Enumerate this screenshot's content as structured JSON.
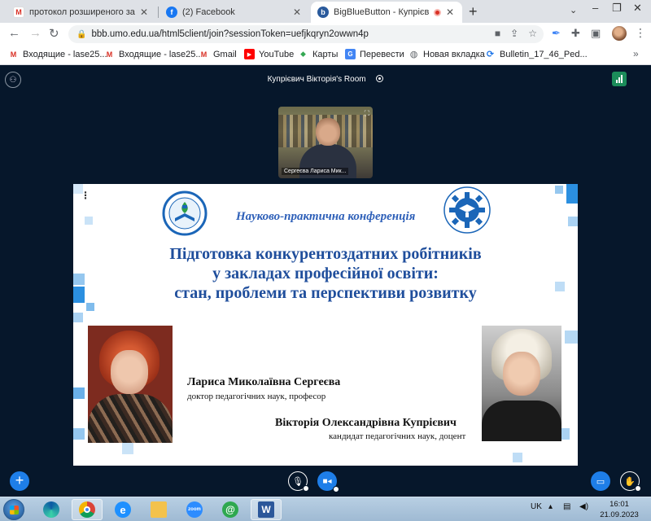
{
  "browser": {
    "tabs": [
      {
        "label": "протокол розширеного засідання",
        "favicon": "gmail-icon",
        "active": false
      },
      {
        "label": "(2) Facebook",
        "favicon": "facebook-icon",
        "active": false
      },
      {
        "label": "BigBlueButton - Купрієвич В",
        "favicon": "bigbluebutton-icon",
        "active": true
      }
    ],
    "url": "bbb.umo.edu.ua/html5client/join?sessionToken=uefjkqryn2owwn4p",
    "bookmarks": [
      {
        "label": "Входящие - lase25...",
        "icon": "gmail-icon"
      },
      {
        "label": "Входящие - lase25...",
        "icon": "gmail-icon"
      },
      {
        "label": "Gmail",
        "icon": "gmail-icon"
      },
      {
        "label": "YouTube",
        "icon": "youtube-icon"
      },
      {
        "label": "Карты",
        "icon": "maps-icon"
      },
      {
        "label": "Перевести",
        "icon": "translate-icon"
      },
      {
        "label": "Новая вкладка",
        "icon": "globe-icon"
      },
      {
        "label": "Bulletin_17_46_Ped...",
        "icon": "link-icon"
      }
    ]
  },
  "meeting": {
    "room_title": "Купрієвич Вікторія's Room",
    "webcam_name": "Сергеєва Лариса Мик..."
  },
  "slide": {
    "conference": "Науково-практична конференція",
    "title_lines": [
      "Підготовка конкурентоздатних робітників",
      "у закладах професійної освіти:",
      "стан, проблеми та перспективи розвитку"
    ],
    "speaker1_name": "Лариса Миколаївна Сергеєва",
    "speaker1_degree": "доктор педагогічних наук, професор",
    "speaker2_name": "Вікторія Олександрівна Купрієвич",
    "speaker2_degree": "кандидат педагогічних наук, доцент"
  },
  "taskbar": {
    "language": "UK",
    "time": "16:01",
    "date": "21.09.2023"
  },
  "colors": {
    "bbb_background": "#06172b",
    "bbb_primary": "#1e7ee8",
    "slide_title": "#1f4e9c",
    "slide_accent": "#2b8fe0"
  }
}
